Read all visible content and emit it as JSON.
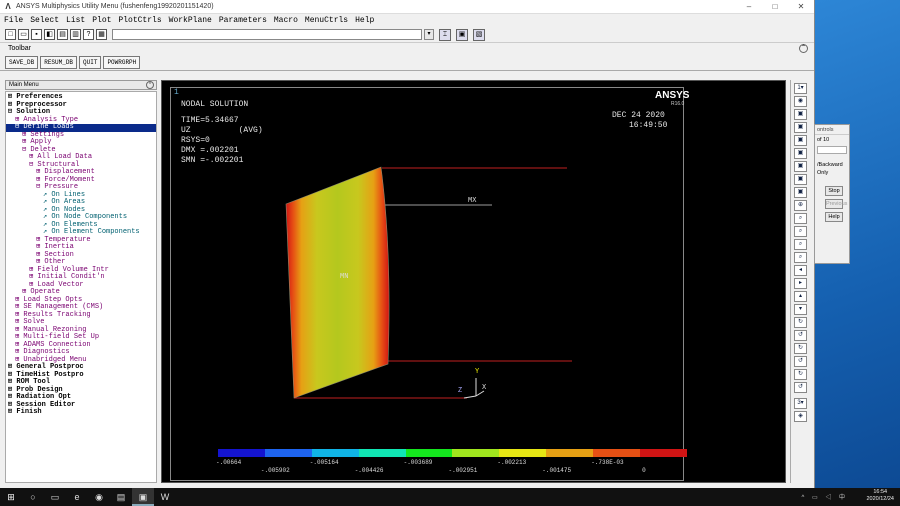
{
  "window": {
    "title": "ANSYS Multiphysics Utility Menu (fushenfeng19920201151420)"
  },
  "menubar": [
    "File",
    "Select",
    "List",
    "Plot",
    "PlotCtrls",
    "WorkPlane",
    "Parameters",
    "Macro",
    "MenuCtrls",
    "Help"
  ],
  "toolbar": {
    "label": "Toolbar",
    "buttons": [
      "SAVE_DB",
      "RESUM_DB",
      "QUIT",
      "POWRGRPH"
    ]
  },
  "main_menu": {
    "title": "Main Menu",
    "items": [
      {
        "label": "⊞ Preferences",
        "depth": 0,
        "style": "b"
      },
      {
        "label": "⊞ Preprocessor",
        "depth": 0,
        "style": "b"
      },
      {
        "label": "⊟ Solution",
        "depth": 0,
        "style": "b"
      },
      {
        "label": "⊞ Analysis Type",
        "depth": 1,
        "style": "m"
      },
      {
        "label": "⊟ Define Loads",
        "depth": 1,
        "style": "sel"
      },
      {
        "label": "⊞ Settings",
        "depth": 2,
        "style": "m"
      },
      {
        "label": "⊞ Apply",
        "depth": 2,
        "style": "m"
      },
      {
        "label": "⊟ Delete",
        "depth": 2,
        "style": "m"
      },
      {
        "label": "⊞ All Load Data",
        "depth": 3,
        "style": "m"
      },
      {
        "label": "⊟ Structural",
        "depth": 3,
        "style": "m"
      },
      {
        "label": "⊞ Displacement",
        "depth": 4,
        "style": "m"
      },
      {
        "label": "⊞ Force/Moment",
        "depth": 4,
        "style": "m"
      },
      {
        "label": "⊟ Pressure",
        "depth": 4,
        "style": "m"
      },
      {
        "label": "↗ On Lines",
        "depth": 5,
        "style": "t"
      },
      {
        "label": "↗ On Areas",
        "depth": 5,
        "style": "t"
      },
      {
        "label": "↗ On Nodes",
        "depth": 5,
        "style": "t"
      },
      {
        "label": "↗ On Node Components",
        "depth": 5,
        "style": "t"
      },
      {
        "label": "↗ On Elements",
        "depth": 5,
        "style": "t"
      },
      {
        "label": "↗ On Element Components",
        "depth": 5,
        "style": "t"
      },
      {
        "label": "⊞ Temperature",
        "depth": 4,
        "style": "m"
      },
      {
        "label": "⊞ Inertia",
        "depth": 4,
        "style": "m"
      },
      {
        "label": "⊞ Section",
        "depth": 4,
        "style": "m"
      },
      {
        "label": "⊞ Other",
        "depth": 4,
        "style": "m"
      },
      {
        "label": "⊞ Field Volume Intr",
        "depth": 3,
        "style": "m"
      },
      {
        "label": "⊞ Initial Condit'n",
        "depth": 3,
        "style": "m"
      },
      {
        "label": "⊞ Load Vector",
        "depth": 3,
        "style": "m"
      },
      {
        "label": "⊞ Operate",
        "depth": 2,
        "style": "m"
      },
      {
        "label": "⊞ Load Step Opts",
        "depth": 1,
        "style": "m"
      },
      {
        "label": "⊞ SE Management (CMS)",
        "depth": 1,
        "style": "m"
      },
      {
        "label": "⊞ Results Tracking",
        "depth": 1,
        "style": "m"
      },
      {
        "label": "⊞ Solve",
        "depth": 1,
        "style": "m"
      },
      {
        "label": "⊞ Manual Rezoning",
        "depth": 1,
        "style": "m"
      },
      {
        "label": "⊞ Multi-field Set Up",
        "depth": 1,
        "style": "m"
      },
      {
        "label": "⊞ ADAMS Connection",
        "depth": 1,
        "style": "m"
      },
      {
        "label": "⊞ Diagnostics",
        "depth": 1,
        "style": "m"
      },
      {
        "label": "⊞ Unabridged Menu",
        "depth": 1,
        "style": "m"
      },
      {
        "label": "⊞ General Postproc",
        "depth": 0,
        "style": "b"
      },
      {
        "label": "⊞ TimeHist Postpro",
        "depth": 0,
        "style": "b"
      },
      {
        "label": "⊞ ROM Tool",
        "depth": 0,
        "style": "b"
      },
      {
        "label": "⊞ Prob Design",
        "depth": 0,
        "style": "b"
      },
      {
        "label": "⊞ Radiation Opt",
        "depth": 0,
        "style": "b"
      },
      {
        "label": "⊞ Session Editor",
        "depth": 0,
        "style": "b"
      },
      {
        "label": "⊞ Finish",
        "depth": 0,
        "style": "b"
      }
    ]
  },
  "plot": {
    "window_number": "1",
    "heading": "NODAL SOLUTION",
    "info": [
      "TIME=5.34667",
      "UZ          (AVG)",
      "RSYS=0",
      "DMX =.002201",
      "SMN =-.002201"
    ],
    "brand": "ANSYS",
    "version": "R16.0",
    "date": "DEC 24 2020",
    "time": "16:49:50",
    "mx_label": "MX",
    "mn_label": "MN",
    "triad": {
      "y": "Y",
      "z": "Z",
      "x": "X"
    },
    "legend_colors": [
      "#1414d0",
      "#1e64f0",
      "#10b4e6",
      "#10e6b4",
      "#14e61e",
      "#a0e61e",
      "#e6e614",
      "#e6a014",
      "#e65014",
      "#d01414"
    ],
    "legend_labels_top": [
      "-.00664",
      "-.005164",
      "-.003689",
      "-.002213",
      "-.738E-03"
    ],
    "legend_labels_bottom": [
      "-.005902",
      "-.004426",
      "-.002951",
      "-.001475",
      "0"
    ]
  },
  "dialog": {
    "title": "ontrols",
    "counter": "of 10",
    "mode": "/Backward",
    "only": "Only",
    "buttons": [
      "Stop",
      "Previous",
      "Help"
    ]
  },
  "taskbar": {
    "time": "16:54",
    "date": "2020/12/24"
  }
}
